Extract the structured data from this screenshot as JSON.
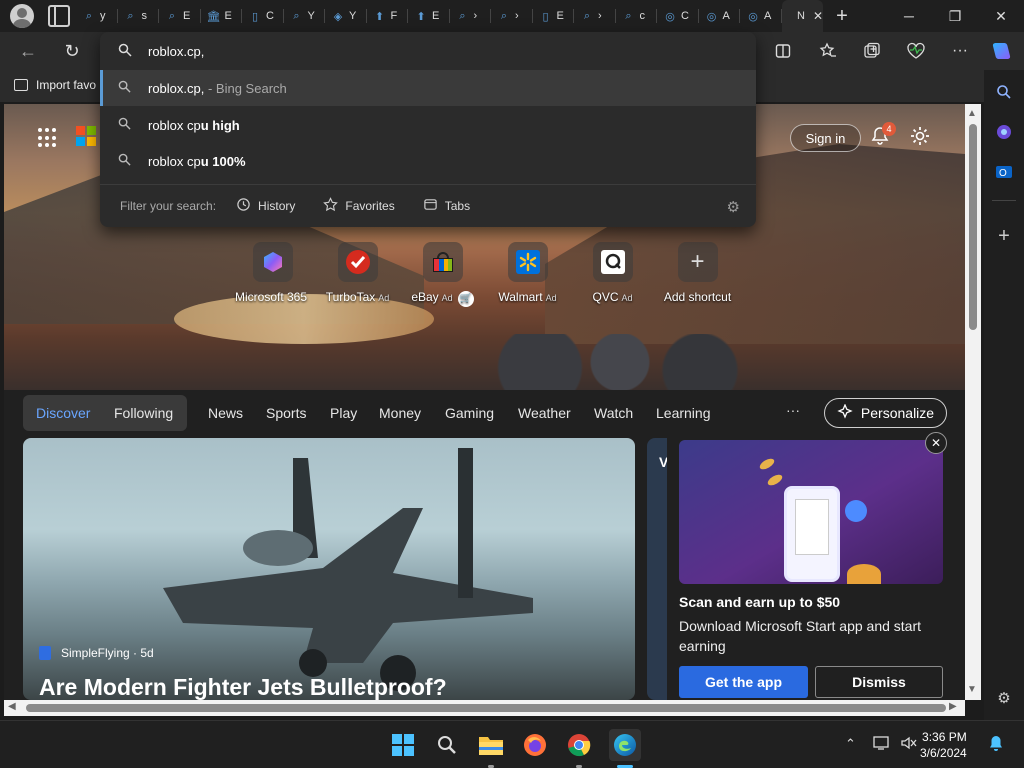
{
  "tabstrip": {
    "tabs": [
      {
        "icon": "search-icon",
        "label": "y"
      },
      {
        "icon": "search-icon",
        "label": "s"
      },
      {
        "icon": "search-icon",
        "label": "E"
      },
      {
        "icon": "bank-icon",
        "label": "E"
      },
      {
        "icon": "document-icon",
        "label": "C"
      },
      {
        "icon": "search-icon",
        "label": "Y"
      },
      {
        "icon": "shield-icon",
        "label": "Y"
      },
      {
        "icon": "arrow-up-icon",
        "label": "F"
      },
      {
        "icon": "arrow-up-icon",
        "label": "E"
      },
      {
        "icon": "search-icon",
        "label": "›"
      },
      {
        "icon": "search-icon",
        "label": "›"
      },
      {
        "icon": "document-icon",
        "label": "E"
      },
      {
        "icon": "search-icon",
        "label": "›"
      },
      {
        "icon": "search-icon",
        "label": "c"
      },
      {
        "icon": "mask-icon",
        "label": "C"
      },
      {
        "icon": "mask-icon",
        "label": "A"
      },
      {
        "icon": "mask-icon",
        "label": "A"
      },
      {
        "icon": "none",
        "label": "N"
      }
    ],
    "new_tab": "+",
    "window": {
      "minimize": "─",
      "restore": "❐",
      "close": "✕"
    }
  },
  "toolbar": {
    "back": "←",
    "refresh": "↻",
    "icons": [
      "split-screen-icon",
      "favorites-icon",
      "collections-icon",
      "performance-icon",
      "more-icon",
      "copilot-icon"
    ]
  },
  "favbar": {
    "import_label": "Import favo"
  },
  "omnibox": {
    "value": "roblox.cp,",
    "suggestions": [
      {
        "text": "roblox.cp,",
        "suffix": " - Bing Search"
      },
      {
        "prefix": "roblox cp",
        "bold": "u high"
      },
      {
        "prefix": "roblox cp",
        "bold": "u 100%"
      }
    ],
    "filter_label": "Filter your search:",
    "filters": [
      {
        "icon": "history-icon",
        "label": "History"
      },
      {
        "icon": "star-icon",
        "label": "Favorites"
      },
      {
        "icon": "tabs-icon",
        "label": "Tabs"
      }
    ]
  },
  "hero": {
    "signin": "Sign in",
    "notif_count": "4",
    "shortcuts": [
      {
        "label": "Microsoft 365",
        "ad": "",
        "icon": "m365-icon"
      },
      {
        "label": "TurboTax",
        "ad": "Ad",
        "icon": "turbotax-icon"
      },
      {
        "label": "eBay",
        "ad": "Ad",
        "icon": "ebay-icon"
      },
      {
        "label": "Walmart",
        "ad": "Ad",
        "icon": "walmart-icon"
      },
      {
        "label": "QVC",
        "ad": "Ad",
        "icon": "qvc-icon"
      },
      {
        "label": "Add shortcut",
        "ad": "",
        "icon": "plus-icon"
      }
    ]
  },
  "nav": {
    "items": [
      "Discover",
      "Following",
      "News",
      "Sports",
      "Play",
      "Money",
      "Gaming",
      "Weather",
      "Watch",
      "Learning"
    ],
    "more": "···",
    "personalize": "Personalize"
  },
  "feed": {
    "source": "SimpleFlying · 5d",
    "headline": "Are Modern Fighter Jets Bulletproof?",
    "card2_letter": "V"
  },
  "promo": {
    "title": "Scan and earn up to $50",
    "desc": "Download Microsoft Start app and start earning",
    "get_app": "Get the app",
    "dismiss": "Dismiss"
  },
  "taskbar": {
    "time": "3:36 PM",
    "date": "3/6/2024",
    "apps": [
      "windows-start-icon",
      "search-icon",
      "file-explorer-icon",
      "firefox-icon",
      "chrome-icon",
      "edge-icon"
    ]
  }
}
